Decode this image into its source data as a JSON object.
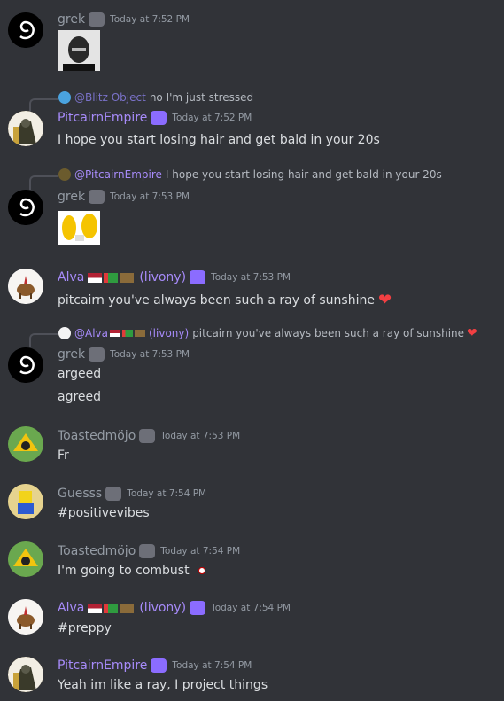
{
  "colors": {
    "background": "#313338",
    "username_gray": "#949ba4",
    "username_purple": "#a78bfa",
    "text": "#dbdee1",
    "timestamp": "#949ba4"
  },
  "messages": [
    {
      "author": "grek",
      "timestamp": "Today at 7:52 PM",
      "attachment": "bald-man-image"
    },
    {
      "reply": {
        "author": "@Blitz Object",
        "text": "no I'm just stressed"
      },
      "author": "PitcairnEmpire",
      "timestamp": "Today at 7:52 PM",
      "text": "I hope you start losing hair and get bald in your 20s"
    },
    {
      "reply": {
        "author": "@PitcairnEmpire",
        "text": "I hope you start losing hair and get bald in your 20s"
      },
      "author": "grek",
      "timestamp": "Today at 7:53 PM",
      "attachment": "emoji-sticker"
    },
    {
      "author": "Alva",
      "author_suffix": "(livony)",
      "timestamp": "Today at 7:53 PM",
      "text": "pitcairn you've always been such a ray of sunshine",
      "emoji": "❤"
    },
    {
      "reply": {
        "author": "@Alva",
        "author_suffix": "(livony)",
        "text": "pitcairn you've always been such a ray of sunshine"
      },
      "author": "grek",
      "timestamp": "Today at 7:53 PM",
      "lines": [
        "argeed",
        "agreed"
      ]
    },
    {
      "author": "Toastedmöjo",
      "timestamp": "Today at 7:53 PM",
      "text": "Fr"
    },
    {
      "author": "Guesss",
      "timestamp": "Today at 7:54 PM",
      "text": "#positivevibes"
    },
    {
      "author": "Toastedmöjo",
      "timestamp": "Today at 7:54 PM",
      "text": "I'm going to combust"
    },
    {
      "author": "Alva",
      "author_suffix": "(livony)",
      "timestamp": "Today at 7:54 PM",
      "text": "#preppy"
    },
    {
      "author": "PitcairnEmpire",
      "timestamp": "Today at 7:54 PM",
      "text": "Yeah im like a ray, I project things"
    }
  ]
}
